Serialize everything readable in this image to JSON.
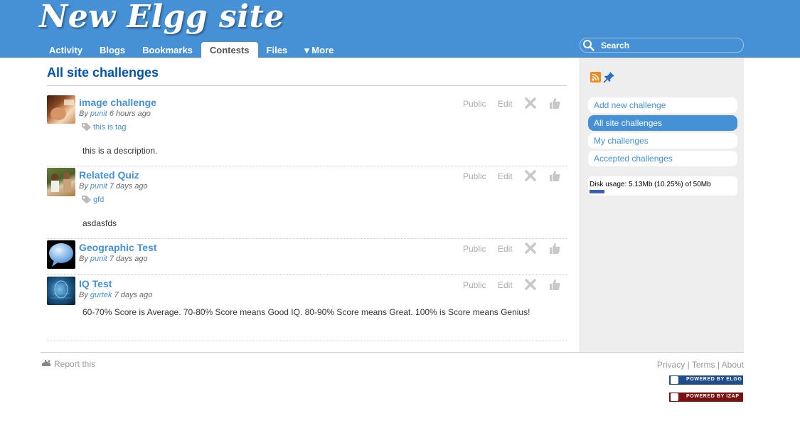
{
  "site": {
    "title": "New Elgg site"
  },
  "nav": {
    "items": [
      {
        "label": "Activity"
      },
      {
        "label": "Blogs"
      },
      {
        "label": "Bookmarks"
      },
      {
        "label": "Contests"
      },
      {
        "label": "Files"
      },
      {
        "label": "▾ More"
      }
    ],
    "active": "Contests"
  },
  "search": {
    "label": "Search"
  },
  "main": {
    "title": "All site challenges",
    "items": [
      {
        "title": "image challenge",
        "by": "By",
        "author": "punit",
        "time": "6 hours ago",
        "tag": "this is tag",
        "description": "this is a description.",
        "access": "Public",
        "edit": "Edit"
      },
      {
        "title": "Related Quiz",
        "by": "By",
        "author": "punit",
        "time": "7 days ago",
        "tag": "gfd",
        "description": "asdasfds",
        "access": "Public",
        "edit": "Edit"
      },
      {
        "title": "Geographic Test",
        "by": "By",
        "author": "punit",
        "time": "7 days ago",
        "access": "Public",
        "edit": "Edit"
      },
      {
        "title": "IQ Test",
        "by": "By",
        "author": "gurtek",
        "time": "7 days ago",
        "description": "60-70% Score is Average. 70-80% Score means Good IQ. 80-90% Score means Great. 100% is Score means Genius!",
        "access": "Public",
        "edit": "Edit"
      }
    ]
  },
  "sidebar": {
    "menu": [
      {
        "label": "Add new challenge"
      },
      {
        "label": "All site challenges"
      },
      {
        "label": "My challenges"
      },
      {
        "label": "Accepted challenges"
      }
    ],
    "disk_usage": {
      "text": "Disk usage: 5.13Mb (10.25%) of 50Mb",
      "percent": 10.25
    }
  },
  "footer": {
    "report": "Report this",
    "links": [
      "Privacy",
      "Terms",
      "About"
    ],
    "separator": "|",
    "badge_elgg": "POWERED BY ELGG",
    "badge_izap": "POWERED BY IZAP"
  },
  "colors": {
    "brand": "#4690d6",
    "title": "#0054a7",
    "active_bg": "#4690d6"
  }
}
